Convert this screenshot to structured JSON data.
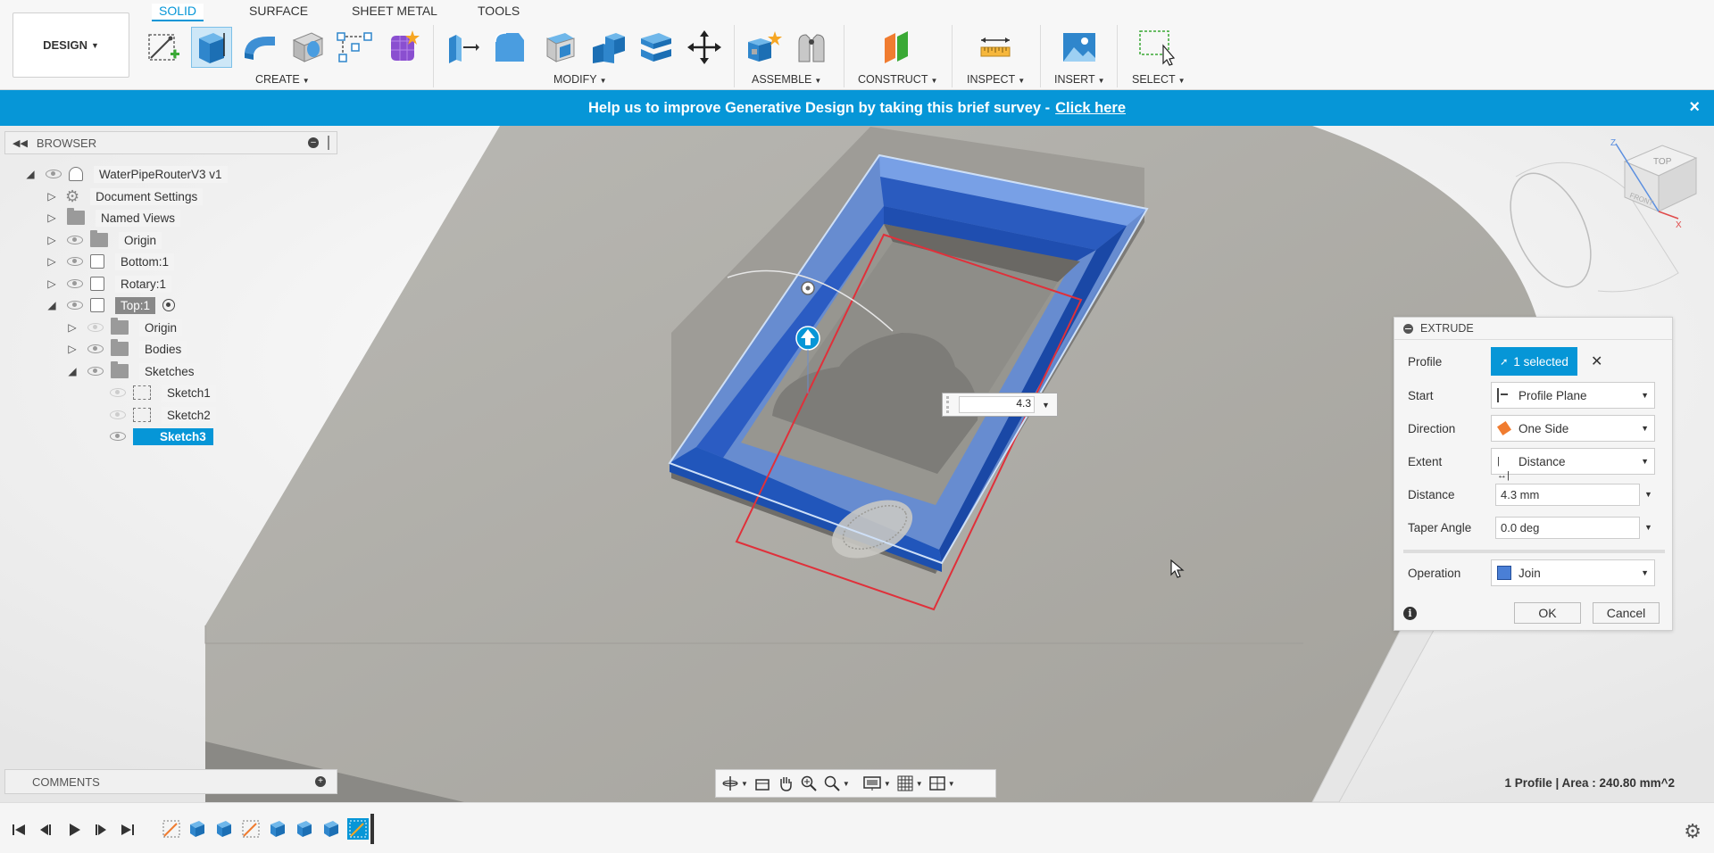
{
  "workspace": {
    "label": "DESIGN"
  },
  "tabs": [
    {
      "label": "SOLID",
      "active": true
    },
    {
      "label": "SURFACE",
      "active": false
    },
    {
      "label": "SHEET METAL",
      "active": false
    },
    {
      "label": "TOOLS",
      "active": false
    }
  ],
  "toolbar_groups": {
    "create": "CREATE",
    "modify": "MODIFY",
    "assemble": "ASSEMBLE",
    "construct": "CONSTRUCT",
    "inspect": "INSPECT",
    "insert": "INSERT",
    "select": "SELECT"
  },
  "banner": {
    "text": "Help us to improve Generative Design by taking this brief survey -",
    "link": "Click here",
    "close": "×"
  },
  "browser": {
    "title": "BROWSER",
    "items": [
      {
        "label": "WaterPipeRouterV3 v1"
      },
      {
        "label": "Document Settings"
      },
      {
        "label": "Named Views"
      },
      {
        "label": "Origin"
      },
      {
        "label": "Bottom:1"
      },
      {
        "label": "Rotary:1"
      },
      {
        "label": "Top:1"
      },
      {
        "label": "Origin"
      },
      {
        "label": "Bodies"
      },
      {
        "label": "Sketches"
      },
      {
        "label": "Sketch1"
      },
      {
        "label": "Sketch2"
      },
      {
        "label": "Sketch3"
      }
    ]
  },
  "comments": {
    "title": "COMMENTS"
  },
  "extrude": {
    "title": "EXTRUDE",
    "profile_label": "Profile",
    "profile_value": "1 selected",
    "start_label": "Start",
    "start_value": "Profile Plane",
    "direction_label": "Direction",
    "direction_value": "One Side",
    "extent_label": "Extent",
    "extent_value": "Distance",
    "distance_label": "Distance",
    "distance_value": "4.3 mm",
    "taper_label": "Taper Angle",
    "taper_value": "0.0 deg",
    "operation_label": "Operation",
    "operation_value": "Join",
    "ok": "OK",
    "cancel": "Cancel",
    "info": "i"
  },
  "viewport": {
    "distance_input": "4.3",
    "viewcube_top": "TOP",
    "viewcube_front": "FRONT",
    "axis_z": "Z",
    "axis_x": "X"
  },
  "status": {
    "text": "1 Profile | Area : 240.80 mm^2"
  },
  "colors": {
    "accent": "#0696d7",
    "selection_blue": "#2f6fd0",
    "profile_outline": "#e0303a"
  }
}
